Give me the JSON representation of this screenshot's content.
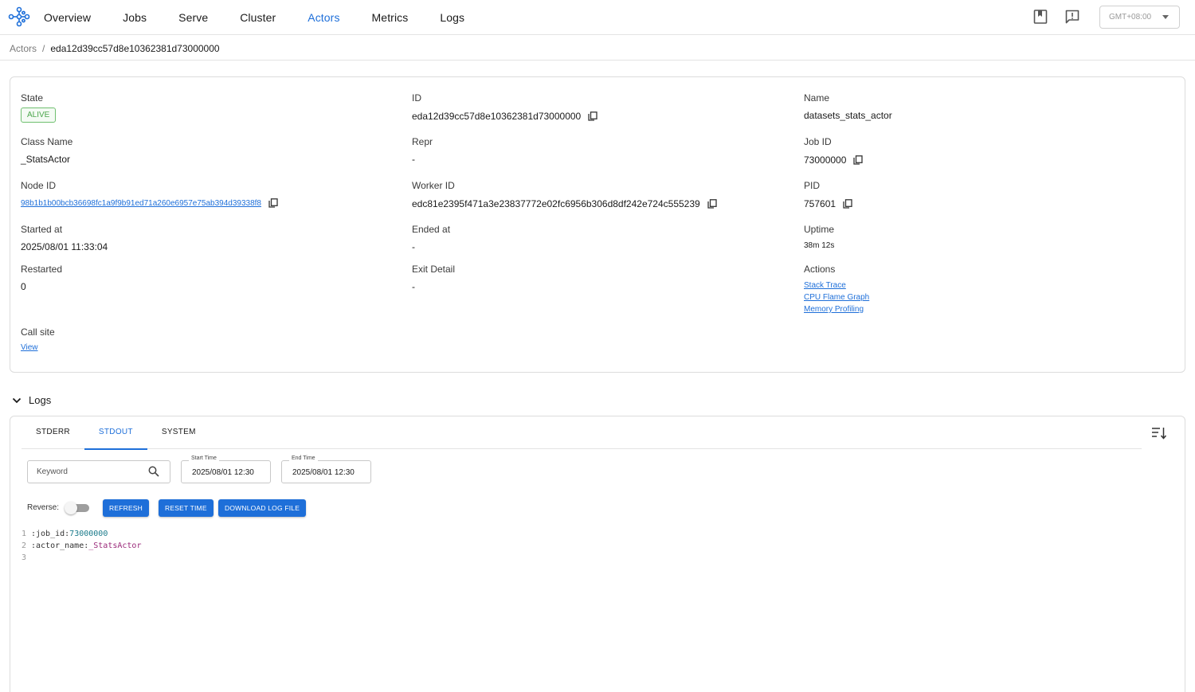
{
  "nav": {
    "items": [
      "Overview",
      "Jobs",
      "Serve",
      "Cluster",
      "Actors",
      "Metrics",
      "Logs"
    ],
    "active": "Actors",
    "icons": [
      "docs-icon",
      "feedback-icon"
    ],
    "timezone": "GMT+08:00"
  },
  "breadcrumb": {
    "parent": "Actors",
    "separator": "/",
    "current": "eda12d39cc57d8e10362381d73000000"
  },
  "actor": {
    "state_label": "State",
    "state_value": "ALIVE",
    "id_label": "ID",
    "id_value": "eda12d39cc57d8e10362381d73000000",
    "name_label": "Name",
    "name_value": "datasets_stats_actor",
    "class_label": "Class Name",
    "class_value": "_StatsActor",
    "repr_label": "Repr",
    "repr_value": "-",
    "job_label": "Job ID",
    "job_value": "73000000",
    "node_label": "Node ID",
    "node_value": "98b1b1b00bcb36698fc1a9f9b91ed71a260e6957e75ab394d39338f8",
    "worker_label": "Worker ID",
    "worker_value": "edc81e2395f471a3e23837772e02fc6956b306d8df242e724c555239",
    "pid_label": "PID",
    "pid_value": "757601",
    "started_label": "Started at",
    "started_value": "2025/08/01 11:33:04",
    "ended_label": "Ended at",
    "ended_value": "-",
    "uptime_label": "Uptime",
    "uptime_value": "38m 12s",
    "restarted_label": "Restarted",
    "restarted_value": "0",
    "exit_label": "Exit Detail",
    "exit_value": "-",
    "actions_label": "Actions",
    "actions": [
      "Stack Trace",
      "CPU Flame Graph",
      "Memory Profiling"
    ],
    "callsite_label": "Call site",
    "callsite_value": "View"
  },
  "logs": {
    "title": "Logs",
    "tabs": [
      "STDERR",
      "STDOUT",
      "SYSTEM"
    ],
    "active_tab": "STDOUT",
    "keyword_placeholder": "Keyword",
    "start_label": "Start Time",
    "start_value": "2025/08/01 12:30",
    "end_label": "End Time",
    "end_value": "2025/08/01 12:30",
    "reverse_label": "Reverse:",
    "reverse_on": false,
    "buttons": {
      "refresh": "REFRESH",
      "reset": "RESET TIME",
      "download": "DOWNLOAD LOG FILE"
    },
    "lines": [
      {
        "num": "1",
        "key": ":job_id:",
        "val": "73000000"
      },
      {
        "num": "2",
        "key": ":actor_name:",
        "val": "_StatsActor"
      },
      {
        "num": "3",
        "key": "",
        "val": ""
      }
    ]
  },
  "colors": {
    "accent": "#1e6fd9",
    "alive_green": "#4ca64c",
    "log_number": "#1a7a8a",
    "log_string": "#9b2a7a"
  }
}
